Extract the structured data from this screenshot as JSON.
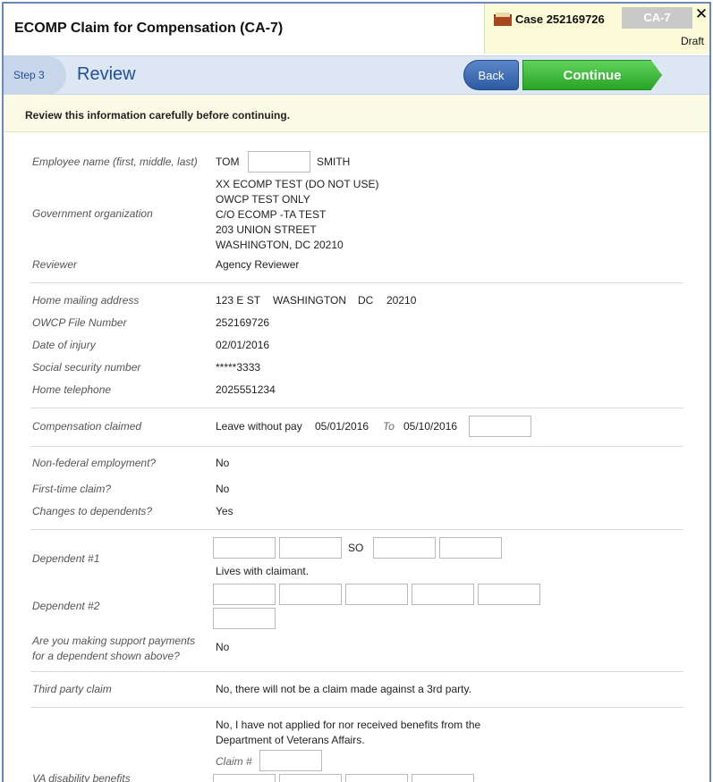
{
  "header": {
    "app_title": "ECOMP Claim for Compensation (CA-7)",
    "case_label": "Case 252169726",
    "form_code": "CA-7",
    "status": "Draft",
    "close_symbol": "✕"
  },
  "step": {
    "label": "Step 3",
    "title": "Review",
    "back_label": "Back",
    "continue_label": "Continue"
  },
  "notice": "Review this information carefully before continuing.",
  "employee": {
    "label": "Employee name (first, middle, last)",
    "first": "TOM",
    "last": "SMITH"
  },
  "government": {
    "label": "Government organization",
    "lines": [
      "XX ECOMP TEST (DO NOT USE)",
      "OWCP TEST ONLY",
      "C/O ECOMP -TA TEST",
      "203 UNION STREET",
      "WASHINGTON, DC 20210"
    ]
  },
  "reviewer": {
    "label": "Reviewer",
    "value": "Agency Reviewer"
  },
  "address": {
    "label": "Home mailing address",
    "street": "123 E ST",
    "city": "WASHINGTON",
    "state": "DC",
    "zip": "20210"
  },
  "file_number": {
    "label": "OWCP File Number",
    "value": "252169726"
  },
  "injury_date": {
    "label": "Date of injury",
    "value": "02/01/2016"
  },
  "ssn": {
    "label": "Social security number",
    "value": "*****3333"
  },
  "telephone": {
    "label": "Home telephone",
    "value": "2025551234"
  },
  "compensation": {
    "label": "Compensation claimed",
    "type": "Leave without pay",
    "from": "05/01/2016",
    "to_label": "To",
    "to": "05/10/2016"
  },
  "non_federal": {
    "label": "Non-federal employment?",
    "value": "No"
  },
  "first_time": {
    "label": "First-time claim?",
    "value": "No"
  },
  "dependents_changes": {
    "label": "Changes to dependents?",
    "value": "Yes"
  },
  "dependent1": {
    "label": "Dependent #1",
    "relation": "SO",
    "note": "Lives with claimant."
  },
  "dependent2": {
    "label": "Dependent #2"
  },
  "support": {
    "label_line1": "Are you making support payments",
    "label_line2": "for a dependent shown above?",
    "value": "No"
  },
  "third_party": {
    "label": "Third party claim",
    "value": "No, there will not be a claim made against a 3rd party."
  },
  "va": {
    "label": "VA disability benefits",
    "line1": "No, I have not applied for nor received benefits from the",
    "line2": "Department of Veterans Affairs.",
    "claim_label": "Claim #"
  }
}
